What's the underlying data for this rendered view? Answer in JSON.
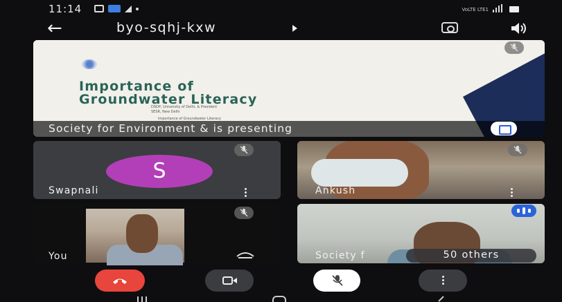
{
  "status_bar": {
    "time": "11:14",
    "network_label": "VoLTE LTE1"
  },
  "meeting": {
    "code": "byo-sqhj-kxw"
  },
  "presentation": {
    "slide_title_line1": "Importance of",
    "slide_title_line2": "Groundwater Literacy",
    "slide_small_text_1": "DSDP, University of Delhi, & President",
    "slide_small_text_2": "SESR, New Delhi",
    "slide_small_text_3": "Importance of Groundwater Literacy",
    "caption": "Society for Environment & is presenting"
  },
  "tiles": [
    {
      "name": "Swapnali",
      "avatar_letter": "S",
      "avatar_color": "#b23fb8"
    },
    {
      "name": "Ankush"
    },
    {
      "name": "You"
    },
    {
      "name": "Society f",
      "others_label": "50 others"
    }
  ],
  "colors": {
    "end_call": "#e8453c",
    "speaking": "#2b63d9",
    "slide_title": "#2a6358",
    "slide_navy": "#1d2d59"
  },
  "icons": {
    "back": "arrow-left-icon",
    "dropdown": "triangle-right-icon",
    "switch_camera": "camera-switch-icon",
    "speaker": "speaker-icon",
    "mic_off": "mic-off-icon",
    "fullscreen": "fullscreen-icon",
    "more": "more-vert-icon",
    "end_call": "phone-hangup-icon",
    "camera": "videocam-icon",
    "effects": "effects-icon"
  }
}
